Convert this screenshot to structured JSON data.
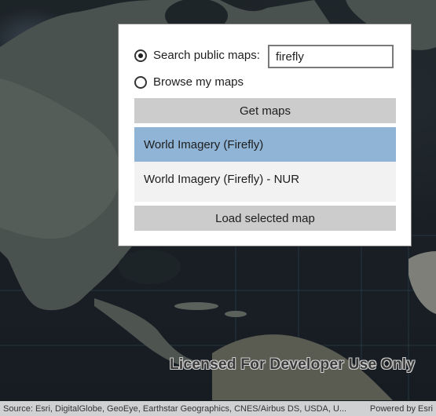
{
  "map": {
    "watermark": "Licensed For Developer Use Only",
    "attribution_source": "Source: Esri, DigitalGlobe, GeoEye, Earthstar Geographics, CNES/Airbus DS, USDA, U...",
    "attribution_powered": "Powered by Esri"
  },
  "panel": {
    "search_option_label": "Search public maps:",
    "search_option_checked": true,
    "search_value": "firefly",
    "browse_option_label": "Browse my maps",
    "browse_option_checked": false,
    "get_maps_label": "Get maps",
    "maps": [
      {
        "title": "World Imagery (Firefly)",
        "selected": true
      },
      {
        "title": "World Imagery (Firefly) - NUR",
        "selected": false
      }
    ],
    "load_label": "Load selected map"
  },
  "colors": {
    "selected_item": "#8fb4d6",
    "button": "#cccccc",
    "list_background": "#f2f2f2"
  }
}
